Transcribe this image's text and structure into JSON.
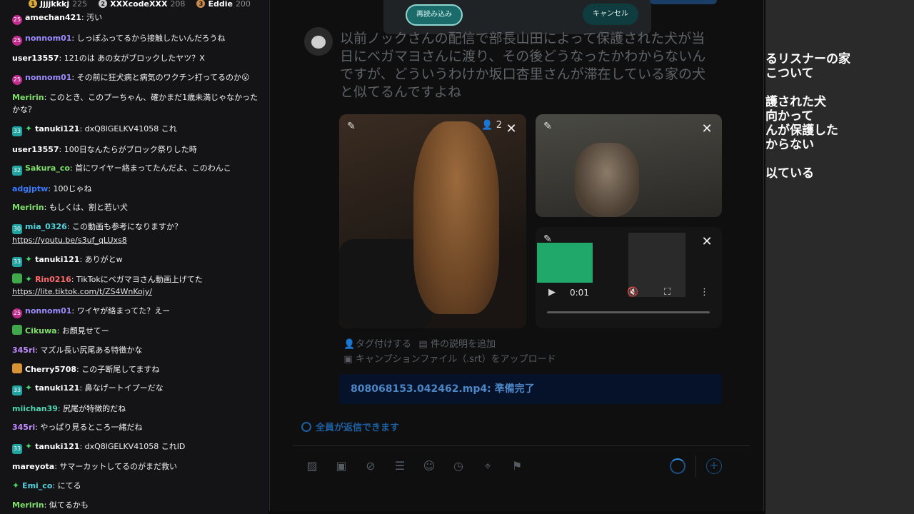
{
  "leaderboard": [
    {
      "rank": "1",
      "name": "Jjjjkkkj",
      "score": "225",
      "color": "#d9a93a"
    },
    {
      "rank": "2",
      "name": "XXXcodeXXX",
      "score": "208",
      "color": "#c8c8c8"
    },
    {
      "rank": "3",
      "name": "Eddie",
      "score": "200",
      "color": "#c88a4a"
    }
  ],
  "chat": [
    {
      "badge": "pink",
      "badge_text": "25",
      "spark": false,
      "user": "amechan421",
      "user_color": "#ffffff",
      "text": "汚い"
    },
    {
      "badge": "pink",
      "badge_text": "25",
      "spark": false,
      "user": "nonnom01",
      "user_color": "#9c8cff",
      "text": "しっぽふってるから接触したいんだろうね"
    },
    {
      "badge": "",
      "badge_text": "",
      "spark": false,
      "user": "user13557",
      "user_color": "#ffffff",
      "text": "121のは あの女がブロックしたヤツ？X"
    },
    {
      "badge": "pink",
      "badge_text": "25",
      "spark": false,
      "user": "nonnom01",
      "user_color": "#9c8cff",
      "text": "その前に狂犬病と病気のワクチン打ってるのか😮"
    },
    {
      "badge": "",
      "badge_text": "",
      "spark": false,
      "user": "Meririn",
      "user_color": "#7ee06a",
      "text": "このとき、このプーちゃん、確かまだ1歳未満じゃなかったかな？"
    },
    {
      "badge": "teal",
      "badge_text": "33",
      "spark": true,
      "user": "tanuki121",
      "user_color": "#ffffff",
      "text": "dxQ8lGELKV41058 これ"
    },
    {
      "badge": "",
      "badge_text": "",
      "spark": false,
      "user": "user13557",
      "user_color": "#ffffff",
      "text": "100日なんたらがブロック祭りした時"
    },
    {
      "badge": "teal",
      "badge_text": "32",
      "spark": false,
      "user": "Sakura_co",
      "user_color": "#7ee06a",
      "text": "首にワイヤー絡まってたんだよ、このわんこ"
    },
    {
      "badge": "",
      "badge_text": "",
      "spark": false,
      "user": "adgjptw",
      "user_color": "#3a7bff",
      "text": "100じゃね"
    },
    {
      "badge": "",
      "badge_text": "",
      "spark": false,
      "user": "Meririn",
      "user_color": "#7ee06a",
      "text": "もしくは、割と若い犬"
    },
    {
      "badge": "teal",
      "badge_text": "30",
      "spark": false,
      "user": "mia_0326",
      "user_color": "#4fd6e0",
      "text": "この動画も参考になりますか？",
      "link": "https://youtu.be/s3uf_qLUxs8"
    },
    {
      "badge": "teal",
      "badge_text": "33",
      "spark": true,
      "user": "tanuki121",
      "user_color": "#ffffff",
      "text": "ありがとw"
    },
    {
      "badge": "green",
      "badge_text": "",
      "spark": true,
      "user": "Rin0216",
      "user_color": "#ff6b6b",
      "text": "TikTokにベガマヨさん動画上げてた",
      "link": "https://lite.tiktok.com/t/ZS4WnKojy/"
    },
    {
      "badge": "pink",
      "badge_text": "25",
      "spark": false,
      "user": "nonnom01",
      "user_color": "#9c8cff",
      "text": "ワイヤが絡まってた？えー"
    },
    {
      "badge": "green",
      "badge_text": "",
      "spark": false,
      "user": "Cikuwa",
      "user_color": "#7ee06a",
      "text": "お顔見せてー"
    },
    {
      "badge": "",
      "badge_text": "",
      "spark": false,
      "user": "345ri",
      "user_color": "#c08cff",
      "text": "マズル長い尻尾ある特徴かな"
    },
    {
      "badge": "amber",
      "badge_text": "",
      "spark": false,
      "user": "Cherry5708",
      "user_color": "#ffffff",
      "text": "この子断尾してますね"
    },
    {
      "badge": "teal",
      "badge_text": "33",
      "spark": true,
      "user": "tanuki121",
      "user_color": "#ffffff",
      "text": "鼻なげートイプーだな"
    },
    {
      "badge": "",
      "badge_text": "",
      "spark": false,
      "user": "miichan39",
      "user_color": "#4fd6b0",
      "text": "尻尾が特徴的だね"
    },
    {
      "badge": "",
      "badge_text": "",
      "spark": false,
      "user": "345ri",
      "user_color": "#c08cff",
      "text": "やっぱり見るところ一緒だね"
    },
    {
      "badge": "teal",
      "badge_text": "33",
      "spark": true,
      "user": "tanuki121",
      "user_color": "#ffffff",
      "text": "dxQ8lGELKV41058 これID"
    },
    {
      "badge": "",
      "badge_text": "",
      "spark": false,
      "user": "mareyota",
      "user_color": "#ffffff",
      "text": "サマーカットしてるのがまだ救い"
    },
    {
      "badge": "",
      "badge_text": "",
      "spark": true,
      "user": "Emi_co",
      "user_color": "#4fd6e0",
      "text": "にてる"
    },
    {
      "badge": "",
      "badge_text": "",
      "spark": false,
      "user": "Meririn",
      "user_color": "#7ee06a",
      "text": "似てるかも"
    }
  ],
  "dialog": {
    "reload_label": "再読み込み",
    "cancel_label": "キャンセル"
  },
  "post": {
    "text": "以前ノックさんの配信で部長山田によって保護された犬が当日にベガマヨさんに渡り、その後どうなったかわからないんですが、どういうわけか坂口杏里さんが滞在している家の犬と似てるんですよね"
  },
  "media": {
    "people_count": "2",
    "video_time": "0:01",
    "tag_label": "タグ付けする",
    "description_label": "件の説明を追加",
    "caption_label": "キャンプションファイル（.srt）をアップロード",
    "upload_status": "808068153.042462.mp4: 準備完了"
  },
  "reply_setting": "全員が返信できます",
  "overlay_lines": [
    "るリスナーの家",
    "こついて",
    "護された犬",
    "向かって",
    "んが保護した",
    "からない",
    "以ている"
  ],
  "icons": {
    "image": "image-icon",
    "gif": "gif-icon",
    "grok": "grok-icon",
    "poll": "poll-icon",
    "emoji": "emoji-icon",
    "schedule": "schedule-icon",
    "location": "location-icon",
    "flag": "flag-icon"
  }
}
